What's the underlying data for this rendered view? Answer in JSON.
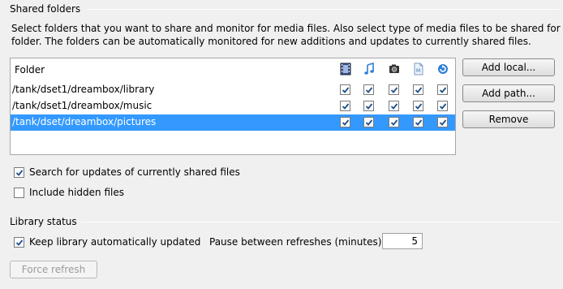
{
  "shared_folders": {
    "title": "Shared folders",
    "description_line1": "Select folders that you want to share and monitor for media files. Also select type of media files to be shared for each",
    "description_line2": "folder. The folders can be automatically monitored for new additions and updates to currently shared files.",
    "table": {
      "header_folder": "Folder",
      "column_icons": [
        "video-icon",
        "music-note-icon",
        "camera-icon",
        "document-icon",
        "refresh-icon"
      ],
      "rows": [
        {
          "path": "/tank/dset1/dreambox/library",
          "checks": [
            true,
            true,
            true,
            true,
            true
          ],
          "selected": false
        },
        {
          "path": "/tank/dset1/dreambox/music",
          "checks": [
            true,
            true,
            true,
            true,
            true
          ],
          "selected": false
        },
        {
          "path": "/tank/dset/dreambox/pictures",
          "checks": [
            true,
            true,
            true,
            true,
            true
          ],
          "selected": true
        }
      ]
    },
    "buttons": {
      "add_local": "Add local...",
      "add_path": "Add path...",
      "remove": "Remove"
    },
    "search_updates": {
      "label": "Search for updates of currently shared files",
      "checked": true
    },
    "include_hidden": {
      "label": "Include hidden files",
      "checked": false
    }
  },
  "library_status": {
    "title": "Library status",
    "keep_updated": {
      "label": "Keep library automatically updated",
      "checked": true
    },
    "pause_label": "Pause between refreshes (minutes):",
    "pause_value": "5",
    "force_refresh": "Force refresh"
  },
  "colors": {
    "selection": "#3399ff",
    "check": "#1f4e8c"
  }
}
